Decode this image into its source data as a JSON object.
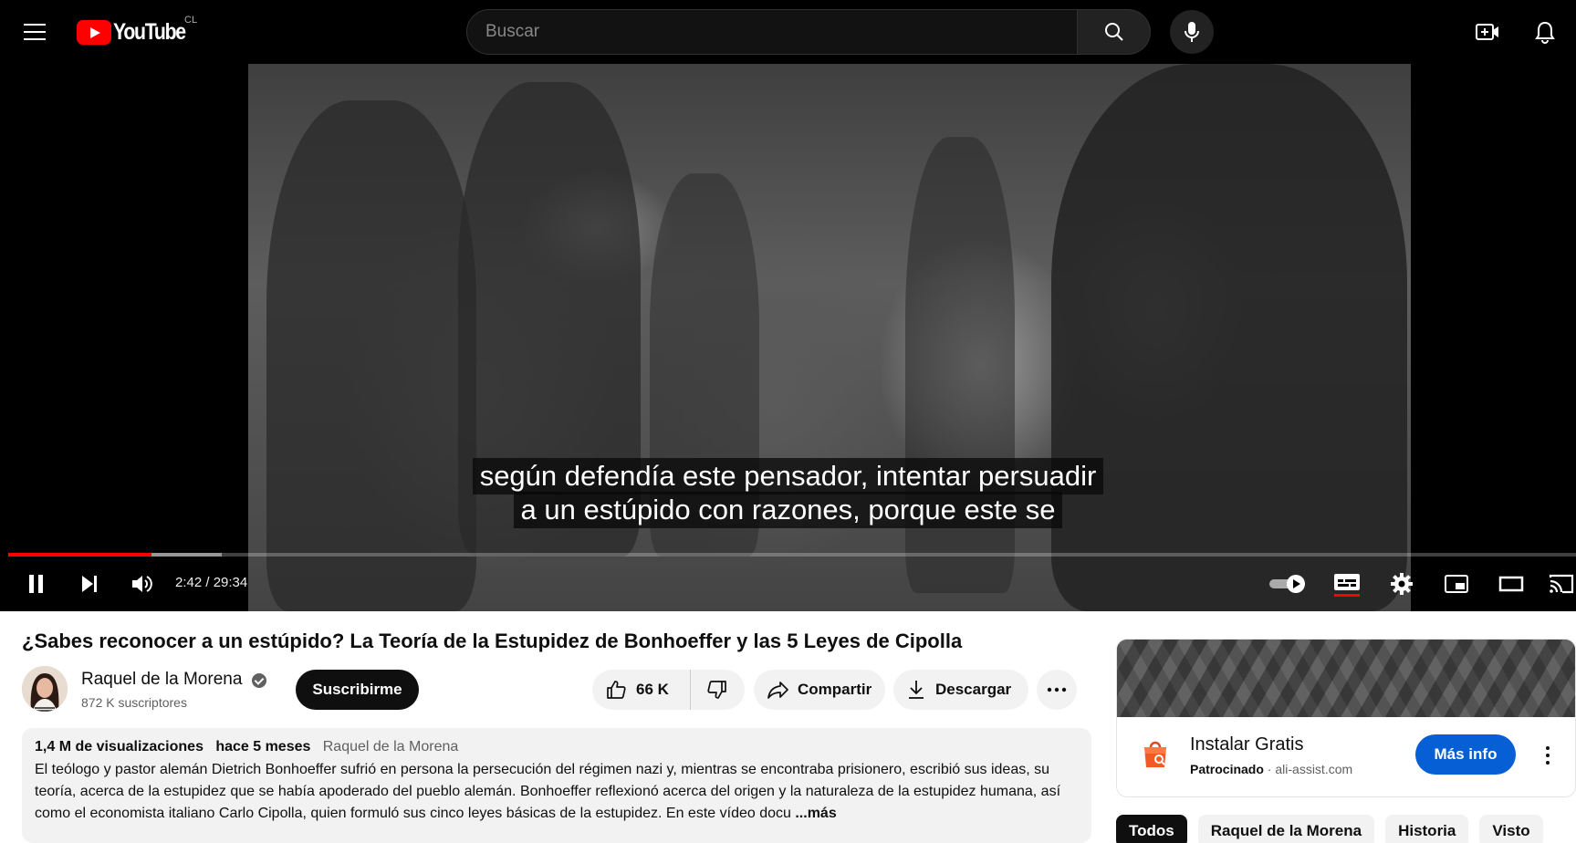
{
  "header": {
    "logo_text": "YouTube",
    "country_code": "CL",
    "search_placeholder": "Buscar",
    "icons": [
      "menu-icon",
      "search-icon",
      "mic-icon",
      "create-video-icon",
      "bell-icon"
    ]
  },
  "player": {
    "subtitles": [
      "según defendía este pensador, intentar persuadir",
      "a un estúpido con razones, porque este se"
    ],
    "current_time": "2:42",
    "duration": "29:34",
    "time_display": "2:42 / 29:34",
    "progress_played_fraction": 0.0913,
    "progress_buffered_fraction": 0.136,
    "controls": [
      "pause-icon",
      "next-icon",
      "volume-icon",
      "autoplay-toggle",
      "subtitles-icon",
      "settings-icon",
      "miniplayer-icon",
      "theater-icon",
      "cast-icon"
    ]
  },
  "video": {
    "title": "¿Sabes reconocer a un estúpido? La Teoría de la Estupidez de Bonhoeffer y las 5 Leyes de Cipolla",
    "channel_name": "Raquel de la Morena",
    "subscribers": "872 K suscriptores",
    "subscribe_label": "Suscribirme",
    "likes": "66 K",
    "share_label": "Compartir",
    "download_label": "Descargar"
  },
  "description": {
    "views": "1,4 M de visualizaciones",
    "date": "hace 5 meses",
    "author": "Raquel de la Morena",
    "text": "El teólogo y pastor alemán Dietrich Bonhoeffer sufrió en persona la persecución del régimen nazi y, mientras se encontraba prisionero, escribió sus ideas, su teoría, acerca de la estupidez que se había apoderado del pueblo alemán. Bonhoeffer reflexionó acerca del origen y la naturaleza de la estupidez humana, así como el economista italiano Carlo Cipolla, quien formuló sus cinco leyes básicas de la estupidez. En este vídeo docu",
    "more_label": "...más"
  },
  "ad": {
    "title": "Instalar Gratis",
    "sponsored": "Patrocinado",
    "domain": "ali-assist.com",
    "cta": "Más info",
    "accent": "#065fd4"
  },
  "chips": [
    "Todos",
    "Raquel de la Morena",
    "Historia",
    "Visto"
  ],
  "colors": {
    "brand_red": "#ff0000",
    "topbar": "#000000"
  }
}
